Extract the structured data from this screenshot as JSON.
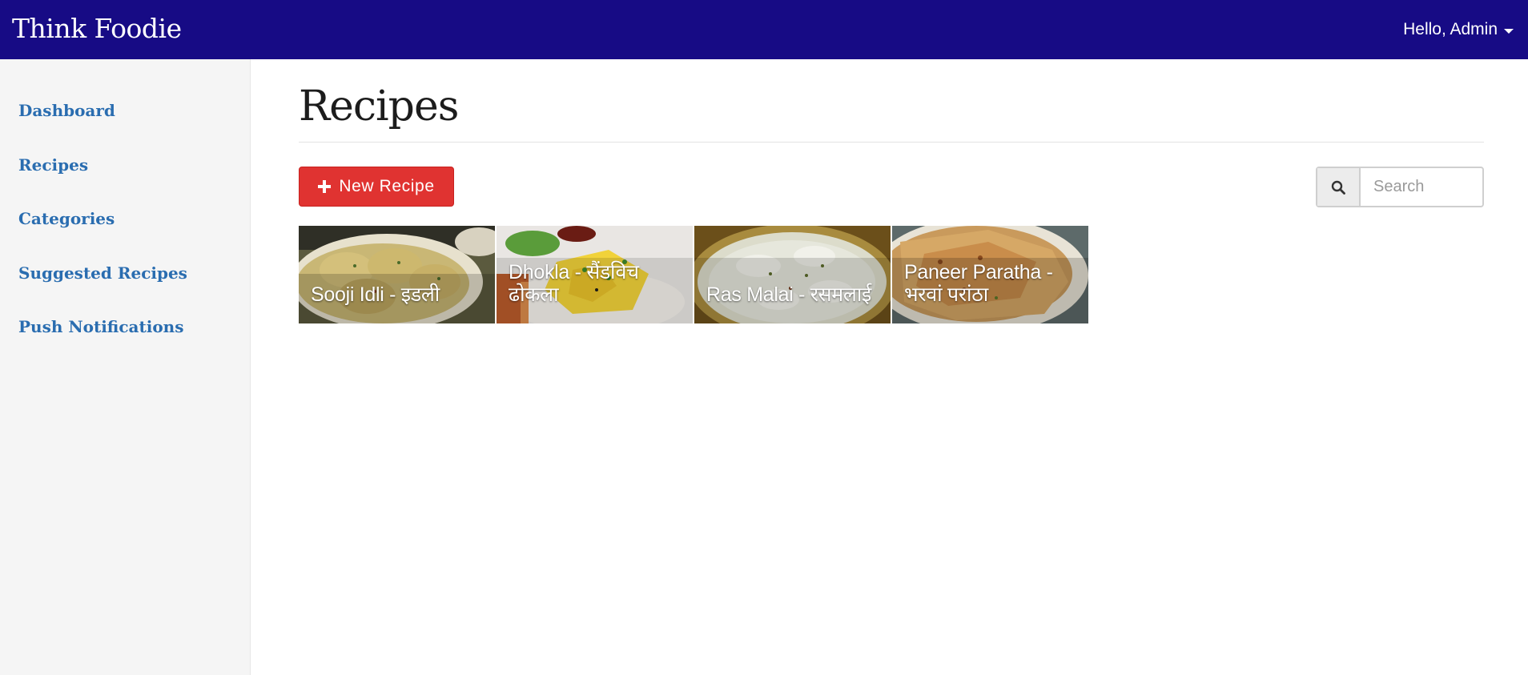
{
  "header": {
    "brand": "Think Foodie",
    "user_label": "Hello, Admin"
  },
  "sidebar": {
    "items": [
      {
        "label": "Dashboard"
      },
      {
        "label": "Recipes"
      },
      {
        "label": "Categories"
      },
      {
        "label": "Suggested Recipes"
      },
      {
        "label": "Push Notifications"
      }
    ]
  },
  "main": {
    "title": "Recipes",
    "new_button_label": "New Recipe",
    "search": {
      "placeholder": "Search",
      "value": ""
    },
    "recipes": [
      {
        "title": "Sooji Idli - इडली",
        "palette": "idli"
      },
      {
        "title": "Dhokla - सैंडविच ढोकला",
        "palette": "dhokla"
      },
      {
        "title": "Ras Malai - रसमलाई",
        "palette": "rasmalai"
      },
      {
        "title": "Paneer Paratha - भरवां परांठा",
        "palette": "paratha"
      }
    ]
  },
  "colors": {
    "navbar": "#170b85",
    "sidebar_bg": "#f5f5f5",
    "link": "#2a6db0",
    "primary_button": "#e03331"
  }
}
